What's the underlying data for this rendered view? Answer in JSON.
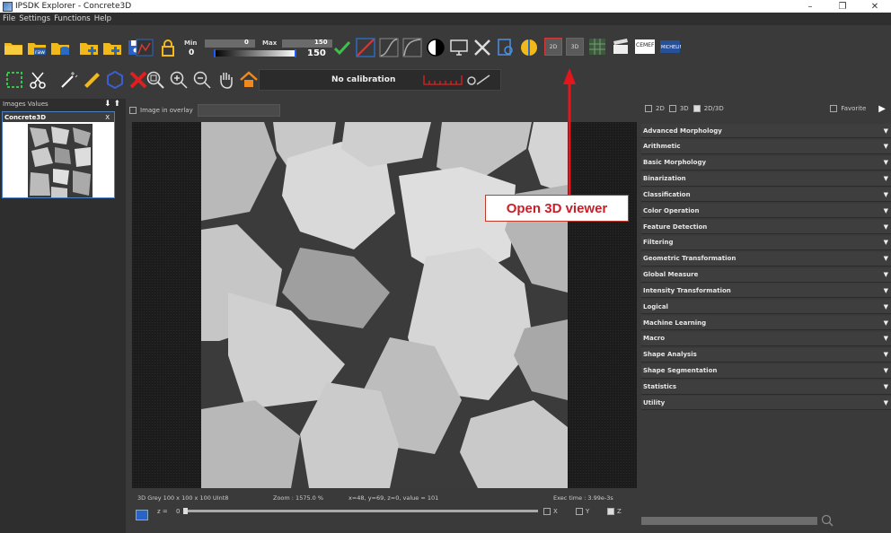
{
  "window": {
    "title": "IPSDK Explorer - Concrete3D",
    "minimize": "–",
    "maximize": "❐",
    "close": "✕"
  },
  "menu": [
    "File",
    "Settings",
    "Functions",
    "Help"
  ],
  "range": {
    "min_label": "Min",
    "max_label": "Max",
    "min_value": "0",
    "max_value": "150",
    "min_current": "0",
    "max_current": "150"
  },
  "view_buttons": {
    "btn_2d": "2D",
    "btn_3d": "3D"
  },
  "calibration": {
    "text": "No calibration"
  },
  "left_panel": {
    "tabs": "Images  Values",
    "image_card_title": "Concrete3D",
    "image_card_close": "X"
  },
  "viewer": {
    "overlay_label": "Image in overlay"
  },
  "status": {
    "info": "3D Grey 100 x 100 x 100 UInt8",
    "zoom": "Zoom : 1575.0 %",
    "coords": "x=48, y=69, z=0, value = 101",
    "exec": "Exec time : 3.99e-3s"
  },
  "slice": {
    "axis_label": "z =",
    "value": "0",
    "x": "X",
    "y": "Y",
    "z": "Z"
  },
  "annotation": {
    "text": "Open 3D viewer",
    "color": "#c8202a"
  },
  "right_panel": {
    "mode_2d": "2D",
    "mode_3d": "3D",
    "mode_2d3d": "2D/3D",
    "favorite": "Favorite",
    "categories": [
      "Advanced Morphology",
      "Arithmetic",
      "Basic Morphology",
      "Binarization",
      "Classification",
      "Color Operation",
      "Feature Detection",
      "Filtering",
      "Geometric Transformation",
      "Global Measure",
      "Intensity Transformation",
      "Logical",
      "Machine Learning",
      "Macro",
      "Shape Analysis",
      "Shape Segmentation",
      "Statistics",
      "Utility"
    ]
  }
}
